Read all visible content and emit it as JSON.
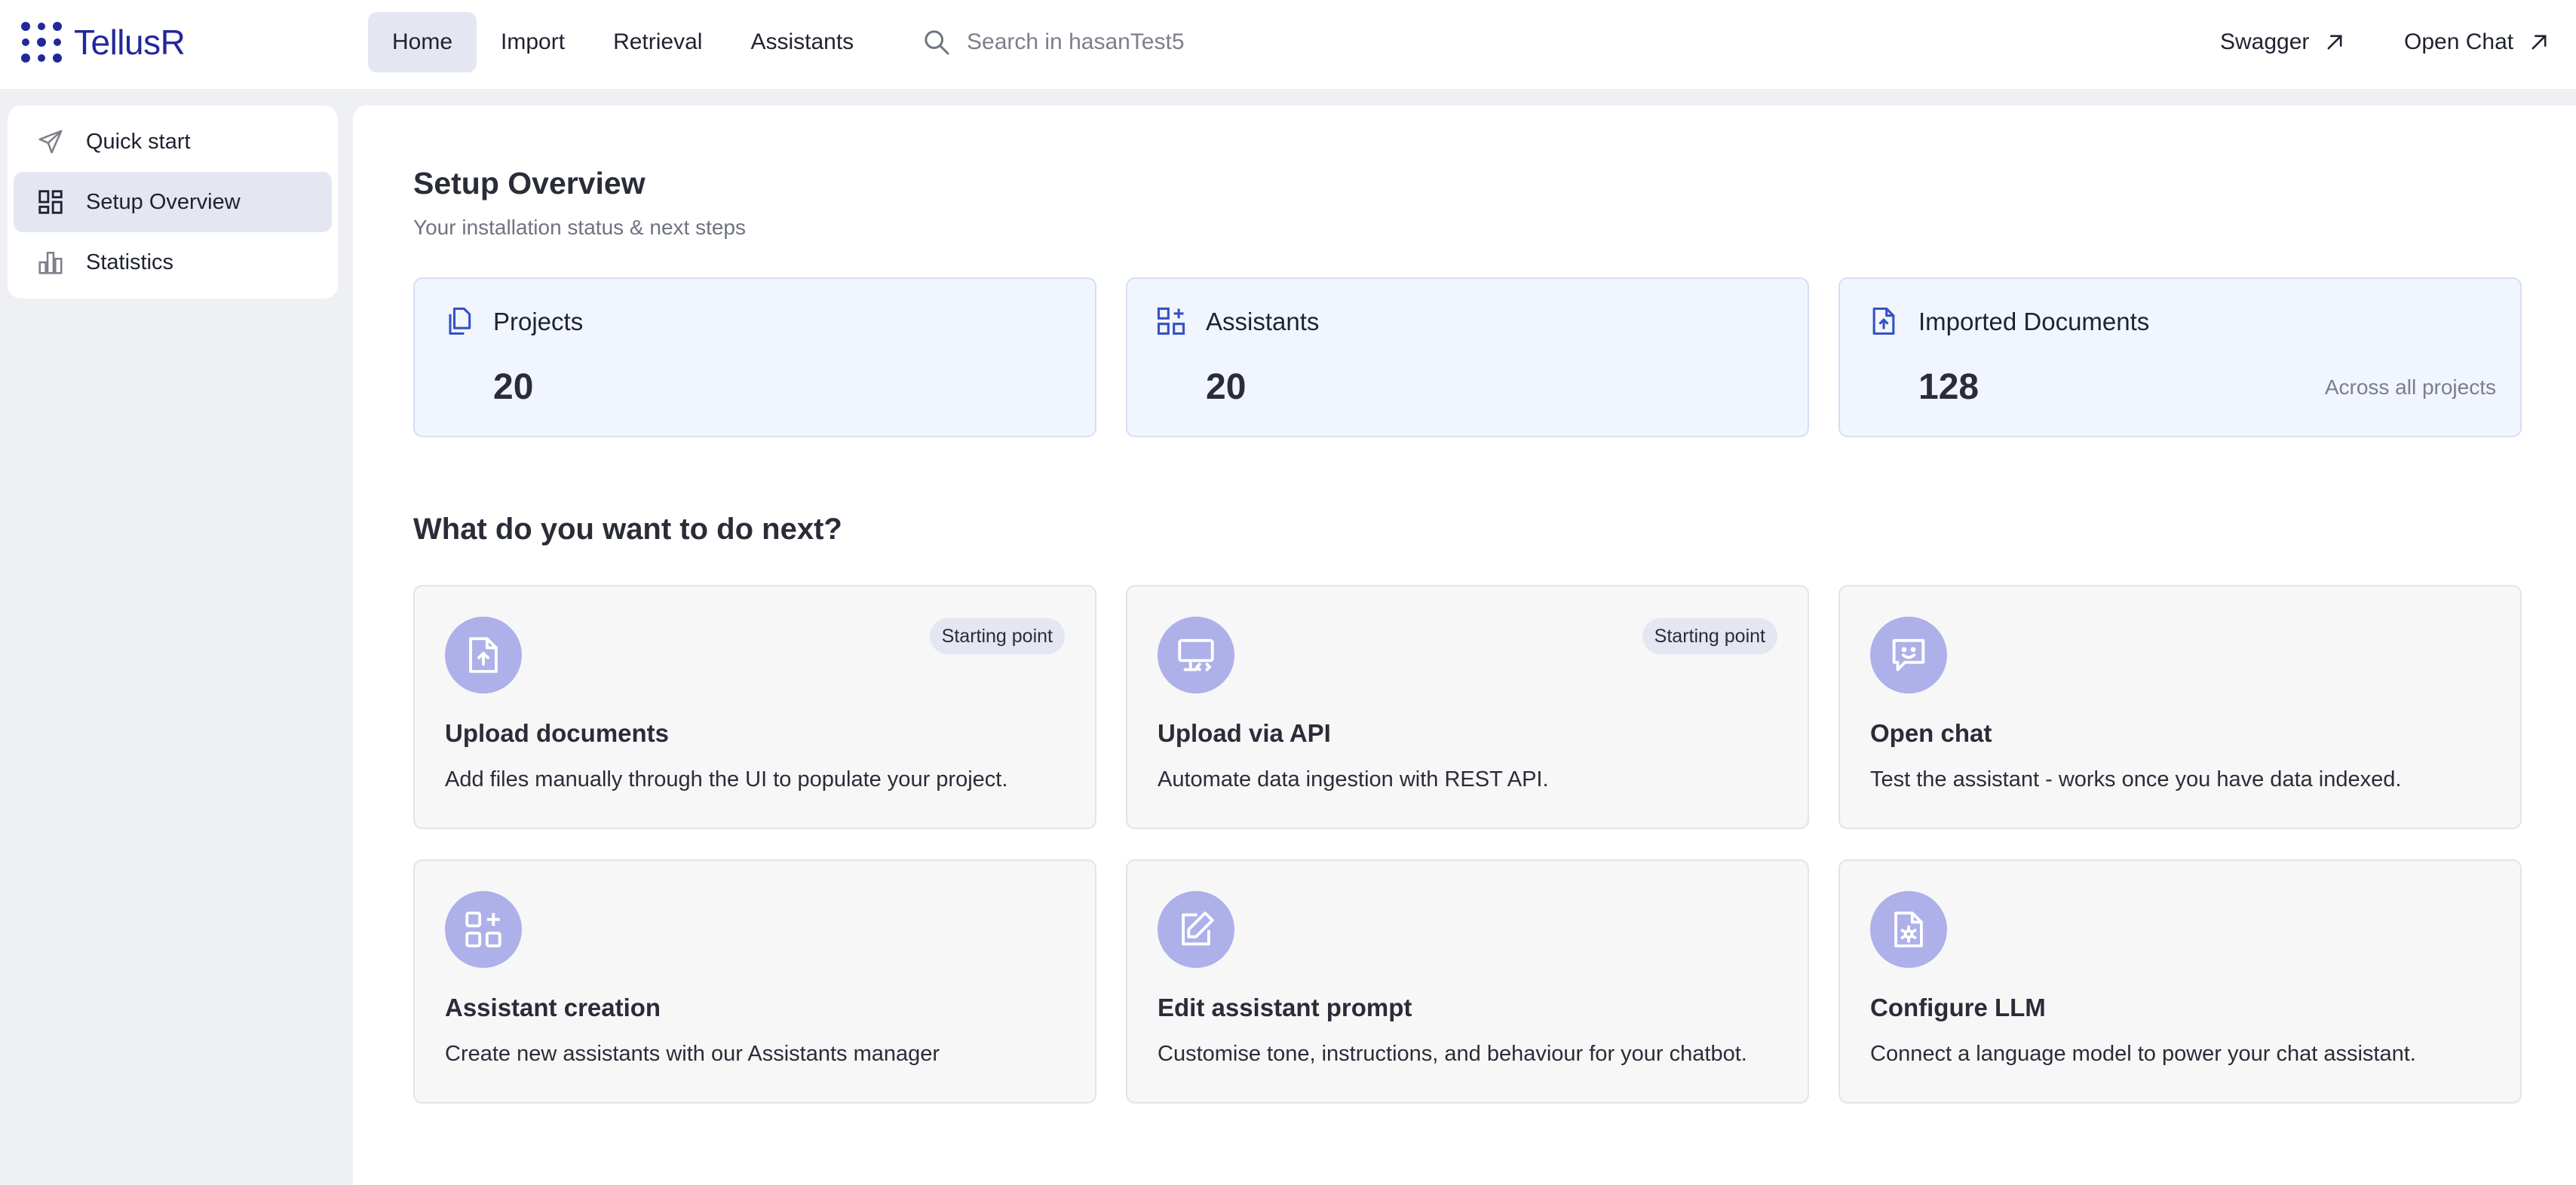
{
  "app": {
    "logo_text": "TellusR"
  },
  "nav": {
    "items": [
      {
        "label": "Home"
      },
      {
        "label": "Import"
      },
      {
        "label": "Retrieval"
      },
      {
        "label": "Assistants"
      }
    ]
  },
  "search": {
    "placeholder": "Search in hasanTest5"
  },
  "top_links": {
    "swagger": "Swagger",
    "open_chat": "Open Chat"
  },
  "sidebar": {
    "items": [
      {
        "label": "Quick start",
        "icon": "send-icon"
      },
      {
        "label": "Setup Overview",
        "icon": "dashboard-icon"
      },
      {
        "label": "Statistics",
        "icon": "bar-chart-icon"
      }
    ]
  },
  "overview": {
    "title": "Setup Overview",
    "subtitle": "Your installation status & next steps",
    "stats": [
      {
        "label": "Projects",
        "value": "20"
      },
      {
        "label": "Assistants",
        "value": "20"
      },
      {
        "label": "Imported Documents",
        "value": "128",
        "note": "Across all projects"
      }
    ]
  },
  "next": {
    "title": "What do you want to do next?",
    "cards": [
      {
        "title": "Upload documents",
        "desc": "Add files manually through the UI to populate your project.",
        "badge": "Starting point",
        "icon": "file-upload-icon"
      },
      {
        "title": "Upload via API",
        "desc": "Automate data ingestion with REST API.",
        "badge": "Starting point",
        "icon": "monitor-code-icon"
      },
      {
        "title": "Open chat",
        "desc": "Test the assistant - works once you have data indexed.",
        "icon": "chat-smile-icon"
      },
      {
        "title": "Assistant creation",
        "desc": "Create new assistants with our Assistants manager",
        "icon": "grid-plus-icon"
      },
      {
        "title": "Edit assistant prompt",
        "desc": "Customise tone, instructions, and behaviour for your chatbot.",
        "icon": "edit-icon"
      },
      {
        "title": "Configure LLM",
        "desc": "Connect a language model to power your chat assistant.",
        "icon": "file-gear-icon"
      }
    ]
  },
  "colors": {
    "brand": "#23279c",
    "accent_icon": "#3552c4",
    "icon_circle": "#aeb0ea",
    "active_bg": "#e4e6f2",
    "stat_card_bg": "#f1f5fe"
  }
}
